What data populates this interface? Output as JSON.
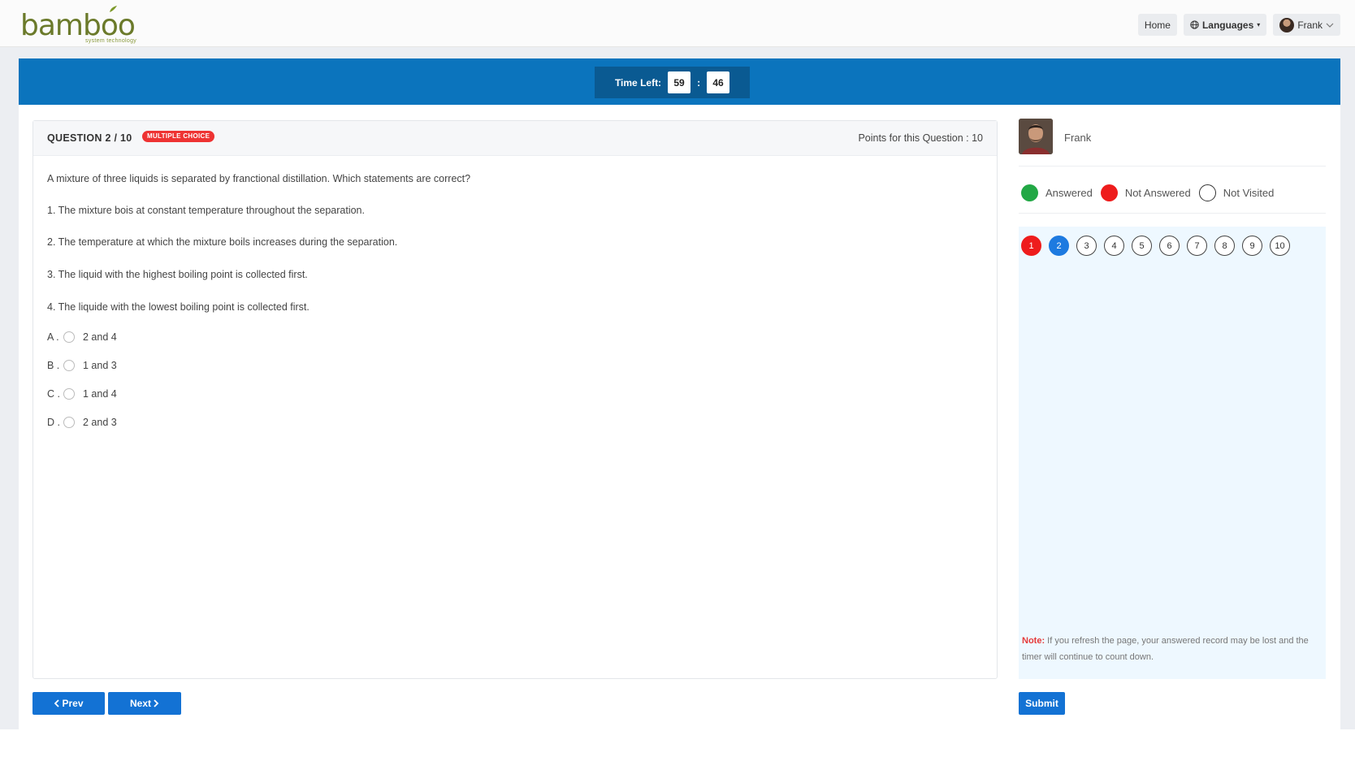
{
  "nav": {
    "logo_text": "bamboo",
    "logo_sub": "system technology",
    "home_label": "Home",
    "languages_label": "Languages",
    "user_label": "Frank"
  },
  "timer": {
    "label": "Time Left:",
    "minutes": "59",
    "separator": ":",
    "seconds": "46"
  },
  "question": {
    "number_label": "QUESTION 2 / 10",
    "type_badge": "MULTIPLE CHOICE",
    "points_label": "Points for this Question : 10",
    "prompt": "A mixture of three liquids is separated by franctional distillation. Which statements are correct?",
    "statements": [
      "1. The mixture bois at constant temperature throughout the separation.",
      "2. The temperature at which the mixture boils increases during the separation.",
      "3. The liquid with the highest boiling point is collected first.",
      "4. The liquide with the lowest boiling point is collected first."
    ],
    "options": [
      {
        "letter": "A .",
        "text": "2 and 4"
      },
      {
        "letter": "B .",
        "text": "1 and 3"
      },
      {
        "letter": "C .",
        "text": "1 and 4"
      },
      {
        "letter": "D .",
        "text": "2 and 3"
      }
    ]
  },
  "buttons": {
    "prev_label": "Prev",
    "next_label": "Next",
    "submit_label": "Submit"
  },
  "profile": {
    "name": "Frank"
  },
  "legend": {
    "answered": "Answered",
    "not_answered": "Not Answered",
    "not_visited": "Not Visited",
    "answered_color": "#22a845",
    "not_answered_color": "#ee1c1c"
  },
  "question_nav": [
    "1",
    "2",
    "3",
    "4",
    "5",
    "6",
    "7",
    "8",
    "9",
    "10"
  ],
  "note": {
    "label": "Note:",
    "text": " If you refresh the page, your answered record may be lost and the timer will continue to count down."
  }
}
